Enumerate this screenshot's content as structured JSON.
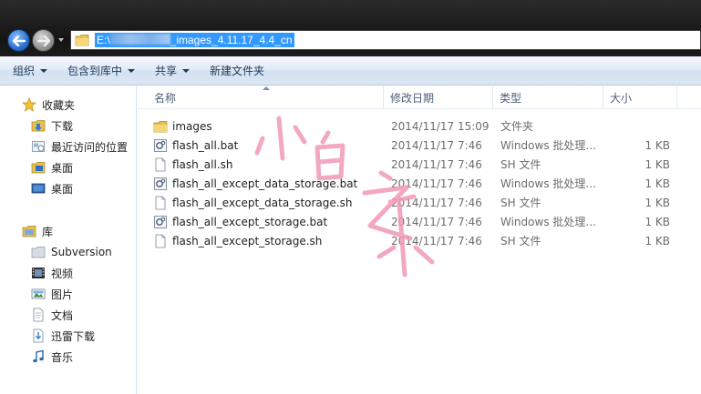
{
  "window": {
    "address": {
      "path_prefix": "E:\\",
      "path_suffix": "_images_4.11.17_4.4_cn"
    }
  },
  "icons": {
    "back": "back-arrow-icon",
    "forward": "forward-arrow-icon",
    "folder": "folder-icon",
    "bat": "batch-file-icon",
    "sh": "document-icon"
  },
  "toolbar": {
    "organize": "组织",
    "include_in_library": "包含到库中",
    "share": "共享",
    "new_folder": "新建文件夹"
  },
  "sidebar": {
    "favorites": {
      "header": "收藏夹",
      "items": [
        {
          "label": "下载",
          "icon": "download-folder-icon"
        },
        {
          "label": "最近访问的位置",
          "icon": "recent-places-icon"
        },
        {
          "label": "桌面",
          "icon": "desktop-folder-icon"
        },
        {
          "label": "桌面",
          "icon": "desktop-icon"
        }
      ]
    },
    "libraries": {
      "header": "库",
      "items": [
        {
          "label": "Subversion",
          "icon": "subversion-icon"
        },
        {
          "label": "视频",
          "icon": "video-icon"
        },
        {
          "label": "图片",
          "icon": "picture-icon"
        },
        {
          "label": "文档",
          "icon": "document-icon"
        },
        {
          "label": "迅雷下载",
          "icon": "thunder-download-icon"
        },
        {
          "label": "音乐",
          "icon": "music-icon"
        }
      ]
    }
  },
  "file_list": {
    "columns": {
      "name": "名称",
      "date_modified": "修改日期",
      "type": "类型",
      "size": "大小"
    },
    "rows": [
      {
        "name": "images",
        "date": "2014/11/17 15:09",
        "type": "文件夹",
        "size": "",
        "icon": "folder-icon"
      },
      {
        "name": "flash_all.bat",
        "date": "2014/11/17 7:46",
        "type": "Windows 批处理...",
        "size": "1 KB",
        "icon": "batch-file-icon"
      },
      {
        "name": "flash_all.sh",
        "date": "2014/11/17 7:46",
        "type": "SH 文件",
        "size": "1 KB",
        "icon": "document-icon"
      },
      {
        "name": "flash_all_except_data_storage.bat",
        "date": "2014/11/17 7:46",
        "type": "Windows 批处理...",
        "size": "1 KB",
        "icon": "batch-file-icon"
      },
      {
        "name": "flash_all_except_data_storage.sh",
        "date": "2014/11/17 7:46",
        "type": "SH 文件",
        "size": "1 KB",
        "icon": "document-icon"
      },
      {
        "name": "flash_all_except_storage.bat",
        "date": "2014/11/17 7:46",
        "type": "Windows 批处理...",
        "size": "1 KB",
        "icon": "batch-file-icon"
      },
      {
        "name": "flash_all_except_storage.sh",
        "date": "2014/11/17 7:46",
        "type": "SH 文件",
        "size": "1 KB",
        "icon": "document-icon"
      }
    ]
  },
  "watermark": {
    "text": "小白之家",
    "color": "#f29ab8"
  },
  "colors": {
    "selection": "#3399ff",
    "titlebar": "#1a1a1a"
  }
}
